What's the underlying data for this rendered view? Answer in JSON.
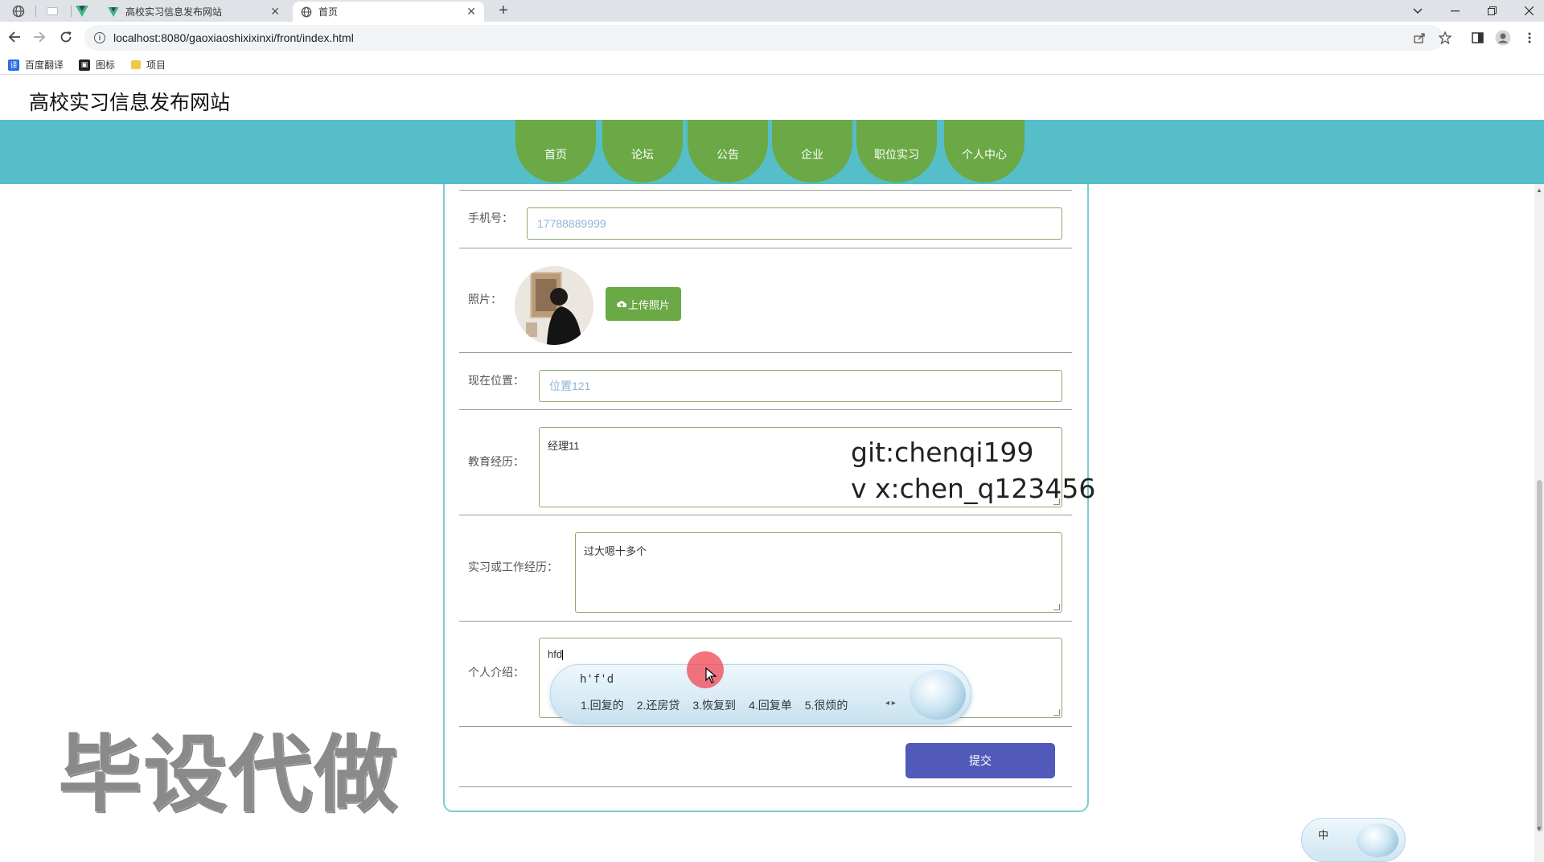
{
  "browser": {
    "tabs": [
      {
        "title": "高校实习信息发布网站",
        "icon": "vue-icon",
        "active": false
      },
      {
        "title": "首页",
        "icon": "globe-icon",
        "active": true
      }
    ],
    "close_glyph": "✕",
    "newtab_glyph": "+",
    "url": "localhost:8080/gaoxiaoshixixinxi/front/index.html",
    "bookmarks": [
      {
        "label": "百度翻译",
        "icon": "translate-icon",
        "color": "#2b6de5"
      },
      {
        "label": "图标",
        "icon": "image-icon",
        "color": "#222222"
      },
      {
        "label": "项目",
        "icon": "folder-icon",
        "color": "#f2c744"
      }
    ]
  },
  "site": {
    "title": "高校实习信息发布网站",
    "nav": [
      "首页",
      "论坛",
      "公告",
      "企业",
      "职位实习",
      "个人中心"
    ]
  },
  "form": {
    "phone": {
      "label": "手机号：",
      "value": "17788889999"
    },
    "photo": {
      "label": "照片：",
      "upload_label": "上传照片"
    },
    "location": {
      "label": "现在位置：",
      "value": "位置121"
    },
    "education": {
      "label": "教育经历：",
      "value": "经理11"
    },
    "experience": {
      "label": "实习或工作经历：",
      "value": "过大嗯十多个"
    },
    "intro": {
      "label": "个人介绍：",
      "value": "hfd"
    },
    "submit_label": "提交"
  },
  "overlay": {
    "line1": "git:chenqi199",
    "line2": "v x:chen_q123456",
    "watermark": "毕设代做"
  },
  "ime": {
    "composition": "h'f'd",
    "candidates": [
      "1.回复的",
      "2.还房贷",
      "3.恢复到",
      "4.回复单",
      "5.很烦的"
    ],
    "arrows": "◂ ▸",
    "mini_label": "中"
  },
  "colors": {
    "nav_band": "#56bec9",
    "nav_item": "#6aa945",
    "submit": "#5159b9",
    "card_border": "#7bcdd3"
  }
}
